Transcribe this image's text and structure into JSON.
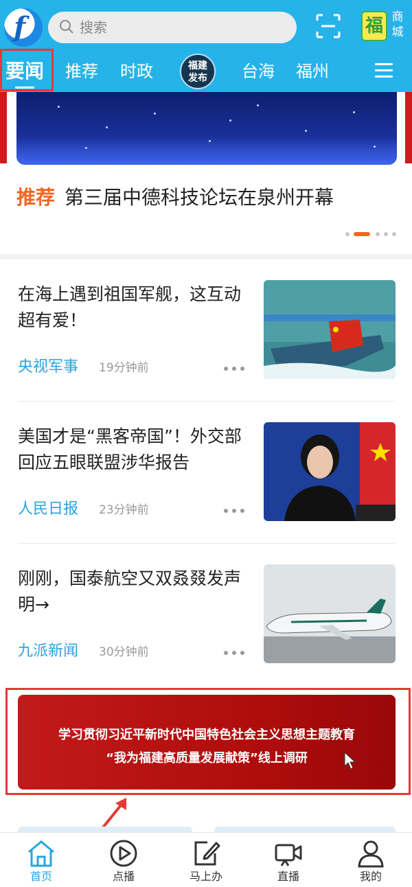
{
  "header": {
    "search_placeholder": "搜索",
    "mall_char": "福",
    "mall_label": "商城",
    "tabs": [
      {
        "label": "要闻",
        "active": true
      },
      {
        "label": "推荐"
      },
      {
        "label": "时政"
      },
      {
        "label": "福建发布",
        "badge": true
      },
      {
        "label": "台海"
      },
      {
        "label": "福州"
      }
    ],
    "badge_line1": "福建",
    "badge_line2": "发布",
    "accent_color": "#26b3ea"
  },
  "banner": {
    "tag": "推荐",
    "headline": "第三届中德科技论坛在泉州开幕",
    "page_count": 5,
    "active_index": 1
  },
  "articles": [
    {
      "title": "在海上遇到祖国军舰，这互动超有爱！",
      "source": "央视军事",
      "time": "19分钟前"
    },
    {
      "title": "美国才是“黑客帝国”！外交部回应五眼联盟涉华报告",
      "source": "人民日报",
      "time": "23分钟前"
    },
    {
      "title": "刚刚，国泰航空又双叒叕发声明→",
      "source": "九派新闻",
      "time": "30分钟前"
    }
  ],
  "promo": {
    "line1": "学习贯彻习近平新时代中国特色社会主义思想主题教育",
    "line2": "“我为福建高质量发展献策”线上调研"
  },
  "bottom_nav": [
    {
      "label": "首页",
      "icon": "home-icon",
      "active": true
    },
    {
      "label": "点播",
      "icon": "play-icon"
    },
    {
      "label": "马上办",
      "icon": "edit-icon"
    },
    {
      "label": "直播",
      "icon": "live-camera-icon"
    },
    {
      "label": "我的",
      "icon": "profile-icon"
    }
  ]
}
